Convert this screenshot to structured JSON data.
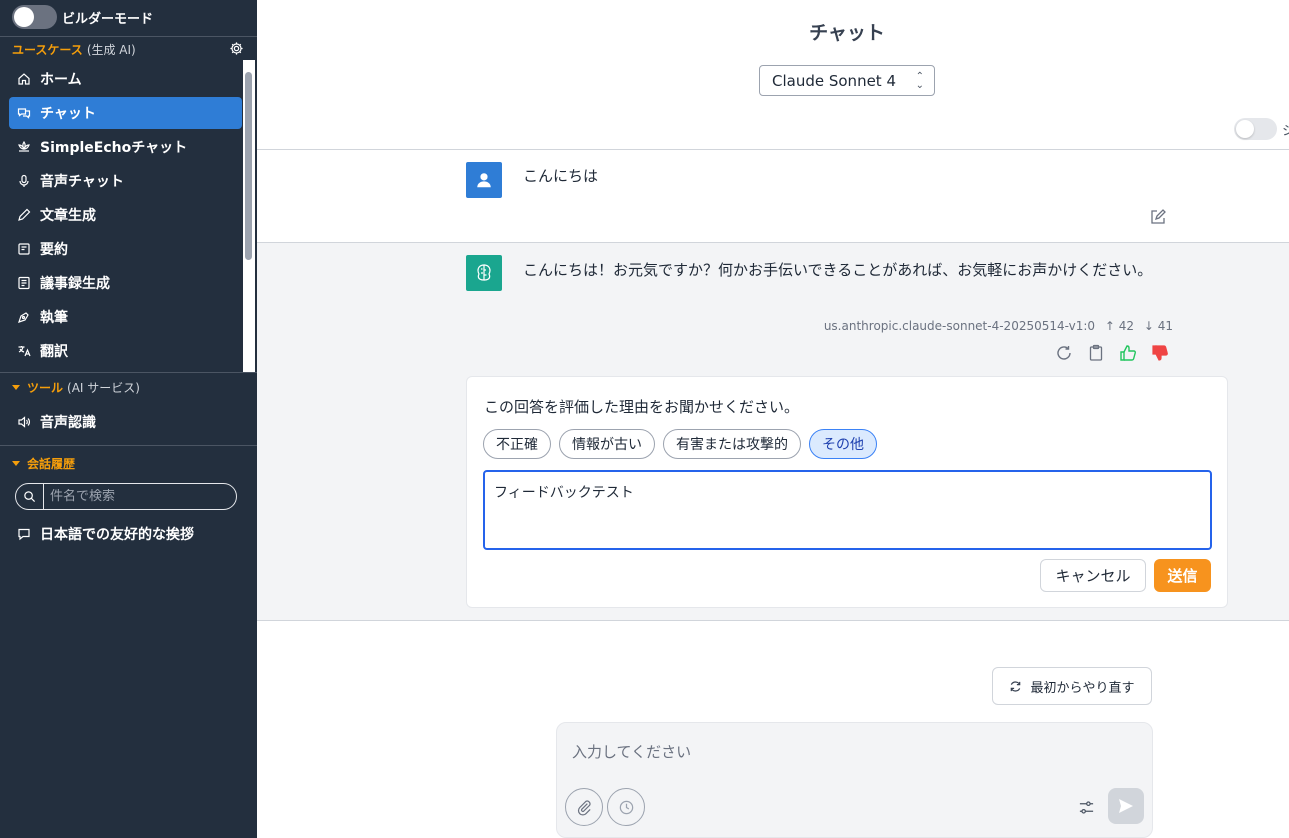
{
  "sidebar": {
    "builder_mode_label": "ビルダーモード",
    "usecase_section": {
      "title": "ユースケース",
      "subtitle": "(生成 AI)"
    },
    "nav_items": [
      {
        "label": "ホーム",
        "icon": "home-icon",
        "active": false
      },
      {
        "label": "チャット",
        "icon": "chat-icon",
        "active": true
      },
      {
        "label": "SimpleEchoチャット",
        "icon": "lotus-icon",
        "active": false
      },
      {
        "label": "音声チャット",
        "icon": "microphone-icon",
        "active": false
      },
      {
        "label": "文章生成",
        "icon": "pencil-icon",
        "active": false
      },
      {
        "label": "要約",
        "icon": "summary-icon",
        "active": false
      },
      {
        "label": "議事録生成",
        "icon": "minutes-icon",
        "active": false
      },
      {
        "label": "執筆",
        "icon": "pen-nib-icon",
        "active": false
      },
      {
        "label": "翻訳",
        "icon": "translate-icon",
        "active": false
      }
    ],
    "tools_section": {
      "title": "ツール",
      "subtitle": "(AI サービス)"
    },
    "tool_items": [
      {
        "label": "音声認識",
        "icon": "speaker-icon"
      }
    ],
    "history_section": {
      "title": "会話履歴"
    },
    "search": {
      "placeholder": "件名で検索",
      "value": ""
    },
    "history_items": [
      {
        "label": "日本語での友好的な挨拶",
        "icon": "chat-bubble-icon"
      }
    ]
  },
  "header": {
    "title": "チャット",
    "model_select": {
      "value": "Claude Sonnet 4"
    }
  },
  "messages": {
    "user": {
      "text": "こんにちは"
    },
    "assistant": {
      "text": "こんにちは！お元気ですか？何かお手伝いできることがあれば、お気軽にお声かけください。",
      "model_id": "us.anthropic.claude-sonnet-4-20250514-v1:0",
      "tokens_in": "↑ 42",
      "tokens_out": "↓ 41"
    }
  },
  "feedback": {
    "question": "この回答を評価した理由をお聞かせください。",
    "reasons": [
      {
        "label": "不正確",
        "selected": false
      },
      {
        "label": "情報が古い",
        "selected": false
      },
      {
        "label": "有害または攻撃的",
        "selected": false
      },
      {
        "label": "その他",
        "selected": true
      }
    ],
    "text_value": "フィードバックテスト",
    "cancel_label": "キャンセル",
    "submit_label": "送信"
  },
  "restart_label": "最初からやり直す",
  "input": {
    "placeholder": "入力してください",
    "value": ""
  },
  "colors": {
    "sidebar": "#232f3e",
    "active_nav": "#2f7dd6",
    "accent": "#f7931e",
    "section_accent": "#f59e0b",
    "bot_avatar": "#1aa68f"
  }
}
